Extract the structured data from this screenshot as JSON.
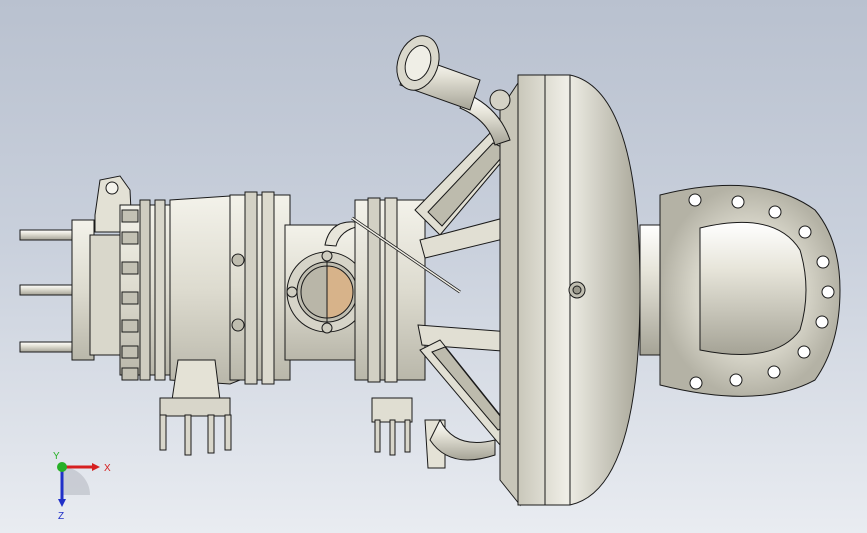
{
  "scene": {
    "background_top": "#b9c1cf",
    "background_bottom": "#e9ecf1",
    "model_color": "#e4e2d6",
    "edge_color": "#1a1a1a",
    "icon": "3d-cad-assembly"
  },
  "triad": {
    "x_label": "X",
    "y_label": "Y",
    "z_label": "Z",
    "x_color": "#d62020",
    "y_color": "#27b027",
    "z_color": "#2030c8"
  }
}
